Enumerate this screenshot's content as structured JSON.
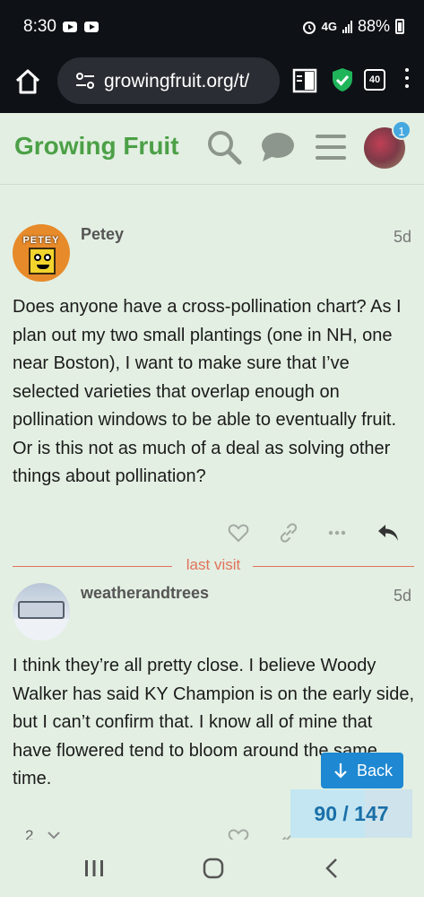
{
  "status_bar": {
    "time": "8:30",
    "network": "4G",
    "battery": "88%"
  },
  "browser": {
    "url": "growingfruit.org/t/",
    "tab_count": "40"
  },
  "site": {
    "title": "Growing Fruit",
    "notification_count": "1"
  },
  "posts": [
    {
      "username": "Petey",
      "age": "5d",
      "avatar_text": "PETEY",
      "body": "Does anyone have a cross-pollination chart? As I plan out my two small plantings (one in NH, one near Boston), I want to make sure that I’ve selected varieties that overlap enough on pollination windows to be able to eventually fruit. Or is this not as much of a deal as solving other things about pollination?"
    },
    {
      "username": "weatherandtrees",
      "age": "5d",
      "body": "I think they’re all pretty close. I believe Woody Walker has said KY Champion is on the early side, but I can’t confirm that. I know all of mine that have flowered tend to bloom around the same time."
    }
  ],
  "divider": {
    "label": "last visit"
  },
  "floating": {
    "back_label": "Back",
    "progress_label": "90 / 147",
    "progress_fraction": 0.61
  },
  "partial": {
    "reply_count": "2"
  },
  "colors": {
    "brand": "#4ca047",
    "accent": "#1e88d2",
    "divider": "#e0725c"
  }
}
